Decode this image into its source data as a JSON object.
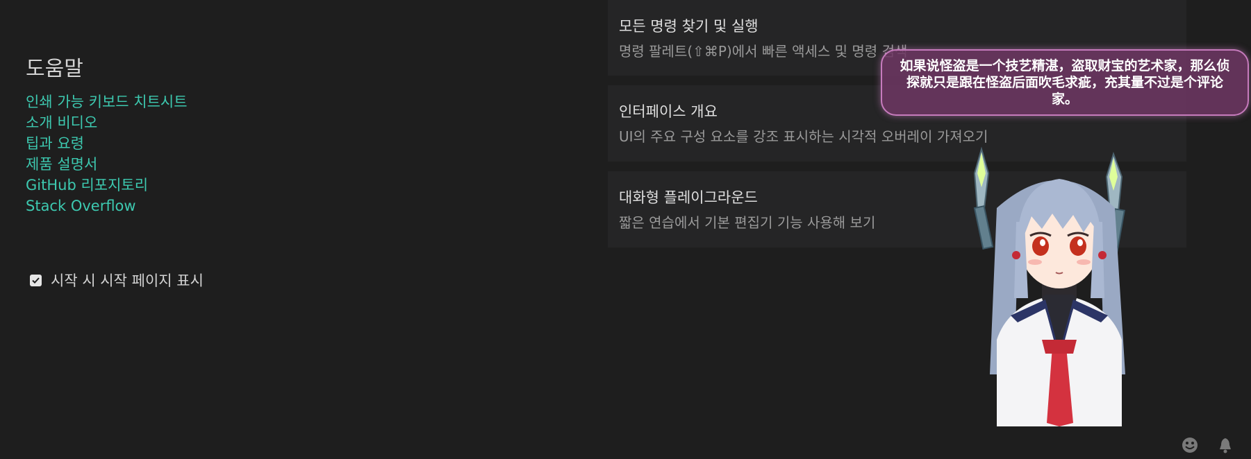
{
  "help": {
    "title": "도움말",
    "links": [
      "인쇄 가능 키보드 치트시트",
      "소개 비디오",
      "팁과 요령",
      "제품 설명서",
      "GitHub 리포지토리",
      "Stack Overflow"
    ]
  },
  "startup": {
    "checked": true,
    "label": "시작 시 시작 페이지 표시"
  },
  "cards": [
    {
      "title": "모든 명령 찾기 및 실행",
      "desc": "명령 팔레트(⇧⌘P)에서 빠른 액세스 및 명령 검색"
    },
    {
      "title": "인터페이스 개요",
      "desc": "UI의 주요 구성 요소를 강조 표시하는 시각적 오버레이 가져오기"
    },
    {
      "title": "대화형 플레이그라운드",
      "desc": "짧은 연습에서 기본 편집기 기능 사용해 보기"
    }
  ],
  "bubble": {
    "text": "如果说怪盗是一个技艺精湛，盗取财宝的艺术家，那么侦探就只是跟在怪盗后面吹毛求疵，充其量不过是个评论家。"
  },
  "status_icons": [
    "smiley-icon",
    "bell-icon"
  ],
  "colors": {
    "background": "#1e1e1e",
    "card": "#252526",
    "link": "#3dc9b0",
    "bubble_border": "#c77bbd"
  }
}
